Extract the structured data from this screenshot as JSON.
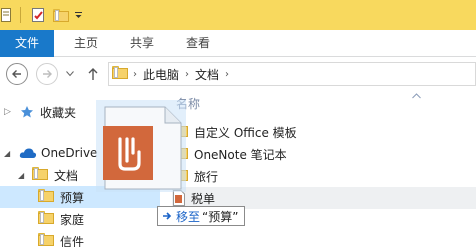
{
  "ribbon": {
    "tabs": [
      {
        "label": "文件"
      },
      {
        "label": "主页"
      },
      {
        "label": "共享"
      },
      {
        "label": "查看"
      }
    ]
  },
  "address": {
    "path": [
      "此电脑",
      "文档"
    ]
  },
  "file_list": {
    "column_header": "名称",
    "items": [
      {
        "label": "自定义 Office 模板"
      },
      {
        "label": "OneNote 笔记本"
      },
      {
        "label": "旅行"
      },
      {
        "label": "税单"
      }
    ]
  },
  "nav_tree": {
    "favorites_label": "收藏夹",
    "onedrive_label": "OneDrive",
    "documents_label": "文档",
    "children": [
      {
        "label": "预算"
      },
      {
        "label": "家庭"
      },
      {
        "label": "信件"
      }
    ]
  },
  "drag": {
    "verb": "移至",
    "target": "“预算”"
  },
  "colors": {
    "titlebar": "#f8d95e",
    "file_tab": "#1979ca",
    "selection": "#cde8ff",
    "accent_blue": "#1b64c8",
    "doc_icon": "#d2683c"
  }
}
